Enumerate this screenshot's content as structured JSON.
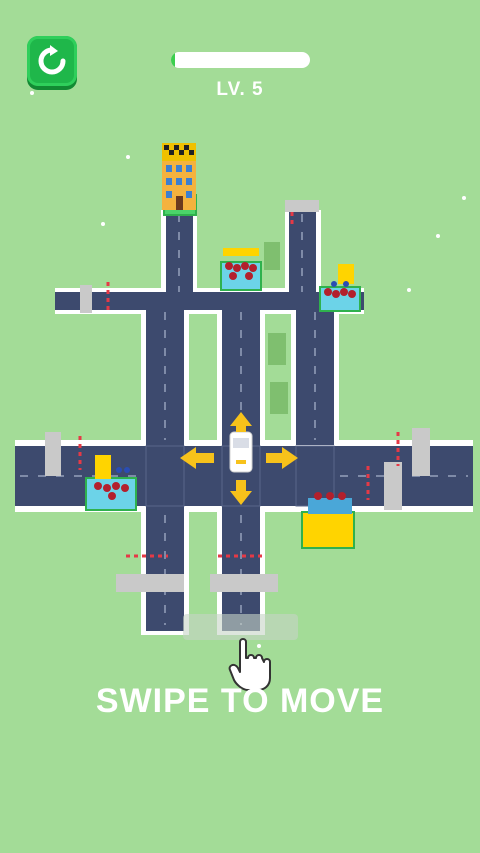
{
  "hud": {
    "restart_icon": "restart-icon",
    "level_label": "LV. 5",
    "progress_fraction": 0.03
  },
  "hint": {
    "text": "SWIPE TO MOVE",
    "hand_icon": "pointer-hand-icon"
  },
  "colors": {
    "background": "#a3dc97",
    "road": "#3d4a6e",
    "road_edge": "#ffffff",
    "restart_button": "#1fb74a",
    "progress_fill": "#3ccf4e",
    "arrow": "#f7c21b",
    "car": "#ffffff",
    "bus_stop_roof": "#ffd400"
  },
  "controls": {
    "direction_arrows": [
      "up",
      "down",
      "left",
      "right"
    ]
  }
}
